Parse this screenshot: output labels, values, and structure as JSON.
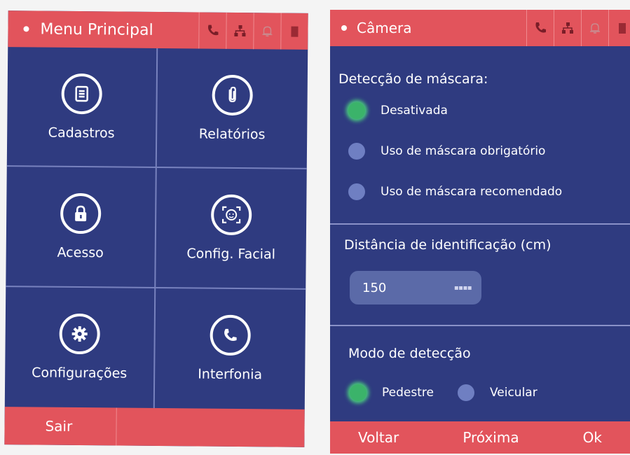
{
  "menu": {
    "title": "Menu Principal",
    "tiles": [
      {
        "label": "Cadastros",
        "icon": "list-icon"
      },
      {
        "label": "Relatórios",
        "icon": "paperclip-icon"
      },
      {
        "label": "Acesso",
        "icon": "lock-icon"
      },
      {
        "label": "Config. Facial",
        "icon": "face-icon"
      },
      {
        "label": "Configurações",
        "icon": "gear-icon"
      },
      {
        "label": "Interfonia",
        "icon": "phone-icon"
      }
    ],
    "bottom": {
      "exit_label": "Sair"
    }
  },
  "camera": {
    "title": "Câmera",
    "mask_detection": {
      "heading": "Detecção de máscara:",
      "options": [
        "Desativada",
        "Uso de máscara obrigatório",
        "Uso de máscara recomendado"
      ],
      "selected": "Desativada"
    },
    "distance": {
      "heading": "Distância de identificação (cm)",
      "value": "150"
    },
    "detection_mode": {
      "heading": "Modo de detecção",
      "options": [
        "Pedestre",
        "Veicular"
      ],
      "selected": "Pedestre"
    },
    "bottom": {
      "back_label": "Voltar",
      "next_label": "Próxima",
      "ok_label": "Ok"
    }
  },
  "status_icons": [
    "phone-icon",
    "network-icon",
    "bell-icon",
    "door-icon"
  ],
  "colors": {
    "header": "#e2545c",
    "panel": "#2f3b80",
    "radio_on": "#3bb36a",
    "radio_off": "#6f7fc2"
  }
}
